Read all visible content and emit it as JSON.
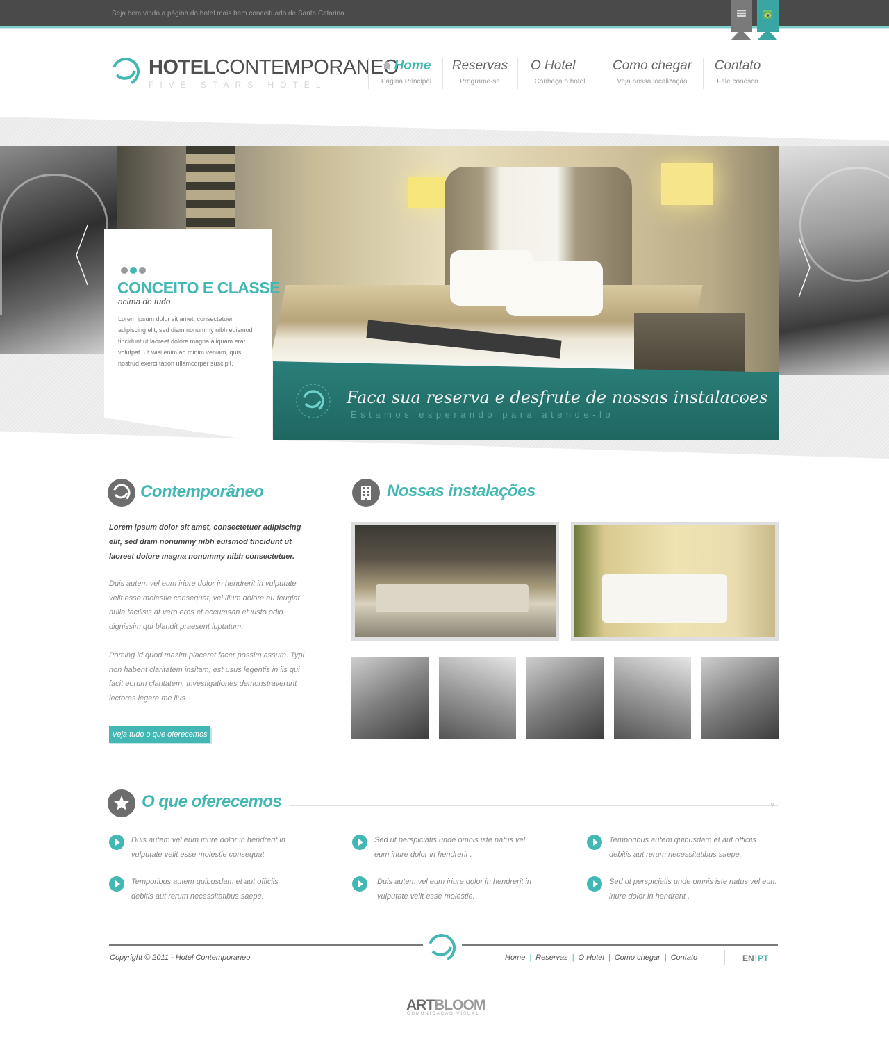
{
  "topbar": {
    "welcome": "Seja bem vindo a página do hotel mais bem conceituado de Santa Catarina"
  },
  "brand": {
    "title_bold": "HOTEL",
    "title_light": "CONTEMPORANEO",
    "subtitle": "FIVE STARS HOTEL"
  },
  "nav": [
    {
      "label": "Home",
      "sub": "Página Principal",
      "active": true
    },
    {
      "label": "Reservas",
      "sub": "Programe-se"
    },
    {
      "label": "O Hotel",
      "sub": "Conheça o hotel"
    },
    {
      "label": "Como chegar",
      "sub": "Veja nossa localização"
    },
    {
      "label": "Contato",
      "sub": "Fale conosco"
    }
  ],
  "slider": {
    "title": "CONCEITO E CLASSE",
    "subtitle": "acima de tudo",
    "text": "Lorem ipsum dolor sit amet, consectetuer adipiscing elit, sed diam nonummy nibh euismod tincidunt ut laoreet dolore magna aliquam erat volutpat. Ut wisi enim ad minim veniam, quis nostrud exerci tation ullamcorper suscipit.",
    "banner_title": "Faca sua reserva e desfrute de nossas instalacoes",
    "banner_sub": "Estamos esperando para atende-lo",
    "banner_arrow": "›"
  },
  "about": {
    "title": "Contemporâneo",
    "lead": "Lorem ipsum dolor sit amet, consectetuer adipiscing elit, sed diam nonummy nibh euismod tincidunt ut laoreet dolore magna nonummy nibh consectetuer.",
    "para1": "Duis autem vel eum iriure dolor in hendrerit in vulputate velit esse molestie consequat, vel illum dolore eu feugiat nulla facilisis at vero eros et accumsan et iusto odio dignissim qui blandit praesent luptatum.",
    "para2": "Poming id quod mazim placerat facer possim assum. Typi non habent claritatem insitam; est usus legentis in iis qui facit eorum claritatem. Investigationes demonstraverunt lectores legere me lius.",
    "cta": "Veja tudo o que oferecemos"
  },
  "gallery": {
    "title": "Nossas instalações"
  },
  "offers": {
    "title": "O que oferecemos",
    "items": [
      "Duis autem vel eum iriure dolor in hendrerit in vulputate velit esse molestie consequat.",
      "Sed ut perspiciatis unde omnis iste natus vel eum iriure dolor in hendrerit .",
      "Temporibus autem quibusdam et aut officiis debitis aut rerum necessitatibus saepe.",
      "Temporibus autem quibusdam et aut officiis debitis aut rerum necessitatibus saepe.",
      "Duis autem vel eum iriure dolor in hendrerit in vulputate velit esse molestie.",
      "Sed ut perspiciatis unde omnis iste natus vel eum iriure dolor in hendrerit ."
    ]
  },
  "footer": {
    "copyright": "Copyright © 2011 - Hotel Contemporaneo",
    "links": [
      "Home",
      "Reservas",
      "O Hotel",
      "Como chegar",
      "Contato"
    ],
    "lang_en": "EN",
    "lang_sep": "|",
    "lang_pt": "PT",
    "credit_bold": "ART",
    "credit_light": "BLOOM",
    "credit_sub": "COMUNICAÇÃO VISUAL"
  },
  "colors": {
    "accent": "#43b7b3",
    "dark_bar": "#4a4a4a",
    "banner": "#237470"
  }
}
